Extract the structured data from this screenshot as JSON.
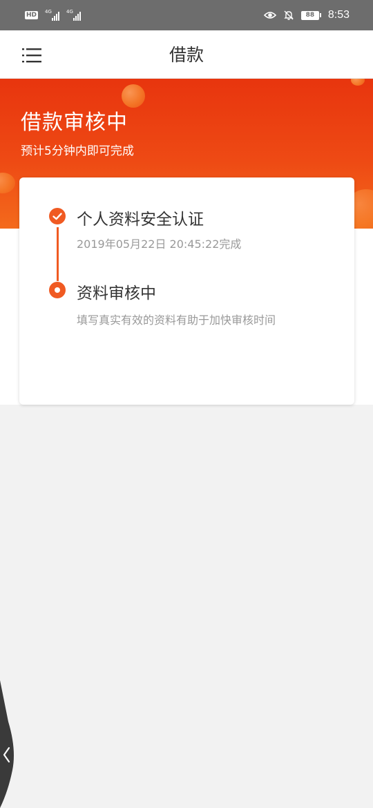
{
  "status_bar": {
    "hd": "HD",
    "network1": "4G",
    "network2": "4G",
    "battery": "88",
    "time": "8:53"
  },
  "nav": {
    "title": "借款",
    "menu_icon": "menu-icon"
  },
  "banner": {
    "title": "借款审核中",
    "subtitle": "预计5分钟内即可完成"
  },
  "steps": [
    {
      "title": "个人资料安全认证",
      "desc": "2019年05月22日 20:45:22完成",
      "state": "done",
      "icon": "check-icon"
    },
    {
      "title": "资料审核中",
      "desc": "填写真实有效的资料有助于加快审核时间",
      "state": "active",
      "icon": "progress-dot-icon"
    }
  ],
  "colors": {
    "accent": "#f05a22",
    "banner_top": "#e8350e",
    "banner_bottom": "#f46a1c",
    "background": "#f2f2f2"
  },
  "edge_handle_icon": "chevron-left-icon"
}
